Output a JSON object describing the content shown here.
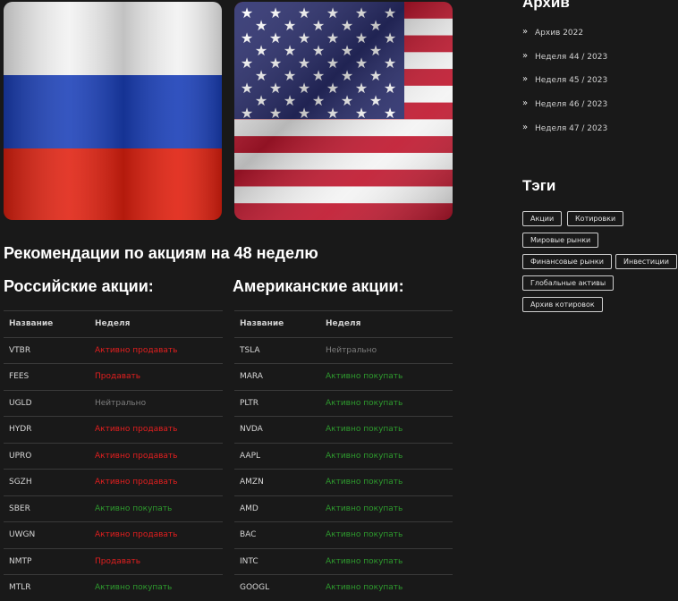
{
  "headline": "Рекомендации по акциям на 48 неделю",
  "russian": {
    "title": "Российские акции:",
    "headers": [
      "Название",
      "Неделя"
    ],
    "rows": [
      {
        "ticker": "VTBR",
        "signal": "Активно продавать"
      },
      {
        "ticker": "FEES",
        "signal": "Продавать"
      },
      {
        "ticker": "UGLD",
        "signal": "Нейтрально"
      },
      {
        "ticker": "HYDR",
        "signal": "Активно продавать"
      },
      {
        "ticker": "UPRO",
        "signal": "Активно продавать"
      },
      {
        "ticker": "SGZH",
        "signal": "Активно продавать"
      },
      {
        "ticker": "SBER",
        "signal": "Активно покупать"
      },
      {
        "ticker": "UWGN",
        "signal": "Активно продавать"
      },
      {
        "ticker": "NMTP",
        "signal": "Продавать"
      },
      {
        "ticker": "MTLR",
        "signal": "Активно покупать"
      }
    ]
  },
  "american": {
    "title": "Американские акции:",
    "headers": [
      "Название",
      "Неделя"
    ],
    "rows": [
      {
        "ticker": "TSLA",
        "signal": "Нейтрально"
      },
      {
        "ticker": "MARA",
        "signal": "Активно покупать"
      },
      {
        "ticker": "PLTR",
        "signal": "Активно покупать"
      },
      {
        "ticker": "NVDA",
        "signal": "Активно покупать"
      },
      {
        "ticker": "AAPL",
        "signal": "Активно покупать"
      },
      {
        "ticker": "AMZN",
        "signal": "Активно покупать"
      },
      {
        "ticker": "AMD",
        "signal": "Активно покупать"
      },
      {
        "ticker": "BAC",
        "signal": "Активно покупать"
      },
      {
        "ticker": "INTC",
        "signal": "Активно покупать"
      },
      {
        "ticker": "GOOGL",
        "signal": "Активно покупать"
      }
    ]
  },
  "sidebar": {
    "archive_title": "Архив",
    "archive_items": [
      "Архив 2022",
      "Неделя 44 / 2023",
      "Неделя 45 / 2023",
      "Неделя 46 / 2023",
      "Неделя 47 / 2023"
    ],
    "tags_title": "Тэги",
    "tags": [
      "Акции",
      "Котировки",
      "Мировые рынки",
      "Финансовые рынки",
      "Инвестиции",
      "Глобальные активы",
      "Архив котировок"
    ]
  },
  "colors": {
    "sell": "#e41f1f",
    "buy": "#2e9a2e",
    "neutral": "#7d7d7d",
    "background": "#191919"
  }
}
